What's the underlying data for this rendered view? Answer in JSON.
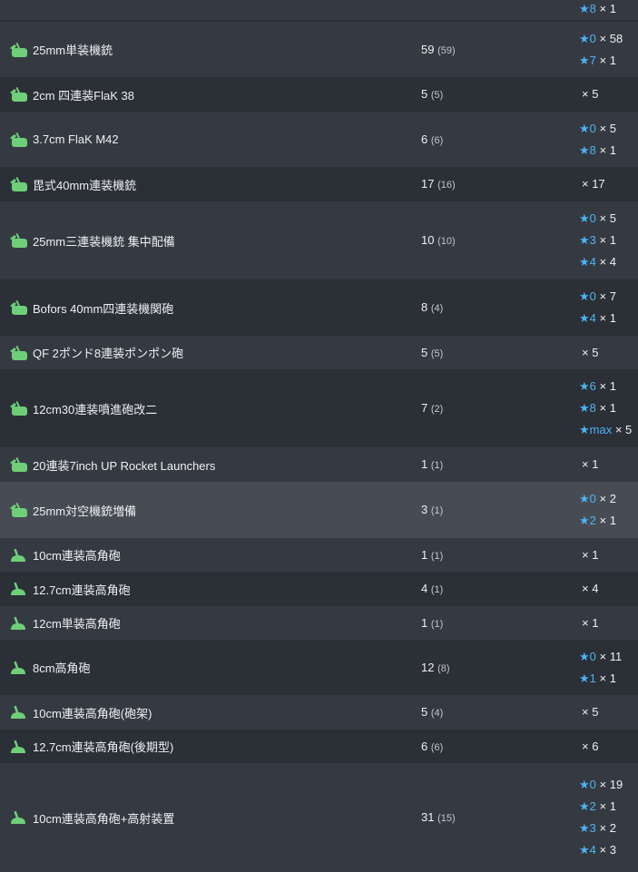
{
  "colors": {
    "star": "#4db3f2",
    "icon": "#6fcf79",
    "row_odd": "#353a42",
    "row_even": "#2b2f36",
    "row_highlight": "#474c54"
  },
  "rows": [
    {
      "name": "",
      "count": "",
      "sub": "",
      "stars": [
        {
          "level": "★8",
          "qty": "× 1"
        }
      ],
      "icon": "none",
      "highlight": false
    },
    {
      "name": "25mm単装機銃",
      "count": "59",
      "sub": "(59)",
      "stars": [
        {
          "level": "★0",
          "qty": "× 58"
        },
        {
          "level": "★7",
          "qty": "× 1"
        }
      ],
      "icon": "aa-gun-icon",
      "highlight": false
    },
    {
      "name": "2cm 四連装FlaK 38",
      "count": "5",
      "sub": "(5)",
      "stars": [
        {
          "level": "",
          "qty": "× 5"
        }
      ],
      "icon": "aa-gun-icon",
      "highlight": false
    },
    {
      "name": "3.7cm FlaK M42",
      "count": "6",
      "sub": "(6)",
      "stars": [
        {
          "level": "★0",
          "qty": "× 5"
        },
        {
          "level": "★8",
          "qty": "× 1"
        }
      ],
      "icon": "aa-gun-icon",
      "highlight": false
    },
    {
      "name": "毘式40mm連装機銃",
      "count": "17",
      "sub": "(16)",
      "stars": [
        {
          "level": "",
          "qty": "× 17"
        }
      ],
      "icon": "aa-gun-icon",
      "highlight": false
    },
    {
      "name": "25mm三連装機銃 集中配備",
      "count": "10",
      "sub": "(10)",
      "stars": [
        {
          "level": "★0",
          "qty": "× 5"
        },
        {
          "level": "★3",
          "qty": "× 1"
        },
        {
          "level": "★4",
          "qty": "× 4"
        }
      ],
      "icon": "aa-gun-icon",
      "highlight": false
    },
    {
      "name": "Bofors 40mm四連装機関砲",
      "count": "8",
      "sub": "(4)",
      "stars": [
        {
          "level": "★0",
          "qty": "× 7"
        },
        {
          "level": "★4",
          "qty": "× 1"
        }
      ],
      "icon": "aa-gun-icon",
      "highlight": false
    },
    {
      "name": "QF 2ポンド8連装ポンポン砲",
      "count": "5",
      "sub": "(5)",
      "stars": [
        {
          "level": "",
          "qty": "× 5"
        }
      ],
      "icon": "aa-gun-icon",
      "highlight": false
    },
    {
      "name": "12cm30連装噴進砲改二",
      "count": "7",
      "sub": "(2)",
      "stars": [
        {
          "level": "★6",
          "qty": "× 1"
        },
        {
          "level": "★8",
          "qty": "× 1"
        },
        {
          "level": "★max",
          "qty": "× 5"
        }
      ],
      "icon": "aa-gun-icon",
      "highlight": false
    },
    {
      "name": "20連装7inch UP Rocket Launchers",
      "count": "1",
      "sub": "(1)",
      "stars": [
        {
          "level": "",
          "qty": "× 1"
        }
      ],
      "icon": "aa-gun-icon",
      "highlight": false
    },
    {
      "name": "25mm対空機銃増備",
      "count": "3",
      "sub": "(1)",
      "stars": [
        {
          "level": "★0",
          "qty": "× 2"
        },
        {
          "level": "★2",
          "qty": "× 1"
        }
      ],
      "icon": "aa-gun-icon",
      "highlight": true
    },
    {
      "name": "10cm連装高角砲",
      "count": "1",
      "sub": "(1)",
      "stars": [
        {
          "level": "",
          "qty": "× 1"
        }
      ],
      "icon": "ha-gun-icon",
      "highlight": false
    },
    {
      "name": "12.7cm連装高角砲",
      "count": "4",
      "sub": "(1)",
      "stars": [
        {
          "level": "",
          "qty": "× 4"
        }
      ],
      "icon": "ha-gun-icon",
      "highlight": false
    },
    {
      "name": "12cm単装高角砲",
      "count": "1",
      "sub": "(1)",
      "stars": [
        {
          "level": "",
          "qty": "× 1"
        }
      ],
      "icon": "ha-gun-icon",
      "highlight": false
    },
    {
      "name": "8cm高角砲",
      "count": "12",
      "sub": "(8)",
      "stars": [
        {
          "level": "★0",
          "qty": "× 11"
        },
        {
          "level": "★1",
          "qty": "× 1"
        }
      ],
      "icon": "ha-gun-icon",
      "highlight": false
    },
    {
      "name": "10cm連装高角砲(砲架)",
      "count": "5",
      "sub": "(4)",
      "stars": [
        {
          "level": "",
          "qty": "× 5"
        }
      ],
      "icon": "ha-gun-icon",
      "highlight": false
    },
    {
      "name": "12.7cm連装高角砲(後期型)",
      "count": "6",
      "sub": "(6)",
      "stars": [
        {
          "level": "",
          "qty": "× 6"
        }
      ],
      "icon": "ha-gun-icon",
      "highlight": false
    },
    {
      "name": "10cm連装高角砲+高射装置",
      "count": "31",
      "sub": "(15)",
      "stars": [
        {
          "level": "★0",
          "qty": "× 19"
        },
        {
          "level": "★2",
          "qty": "× 1"
        },
        {
          "level": "★3",
          "qty": "× 2"
        },
        {
          "level": "★4",
          "qty": "× 3"
        }
      ],
      "icon": "ha-gun-icon",
      "highlight": false
    }
  ]
}
